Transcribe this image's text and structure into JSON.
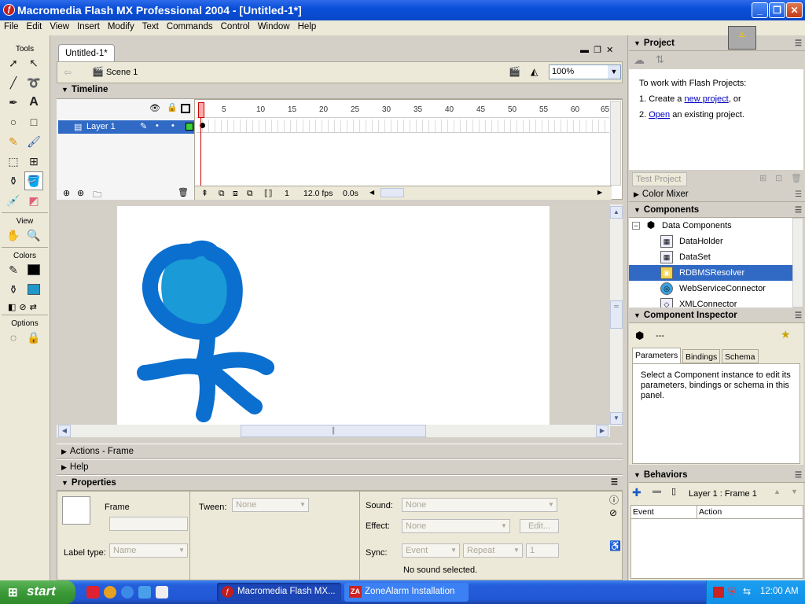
{
  "window": {
    "title": "Macromedia Flash MX Professional 2004 - [Untitled-1*]"
  },
  "menu": [
    "File",
    "Edit",
    "View",
    "Insert",
    "Modify",
    "Text",
    "Commands",
    "Control",
    "Window",
    "Help"
  ],
  "tools": {
    "section_tools": "Tools",
    "section_view": "View",
    "section_colors": "Colors",
    "section_options": "Options",
    "stroke_color": "#000000",
    "fill_color": "#2196c8"
  },
  "document": {
    "tab": "Untitled-1*",
    "scene": "Scene 1",
    "zoom": "100%"
  },
  "timeline": {
    "title": "Timeline",
    "layer_name": "Layer 1",
    "ruler": [
      "1",
      "5",
      "10",
      "15",
      "20",
      "25",
      "30",
      "35",
      "40",
      "45",
      "50",
      "55",
      "60",
      "65"
    ],
    "current_frame": "1",
    "fps": "12.0 fps",
    "time": "0.0s"
  },
  "panels": {
    "actions": "Actions - Frame",
    "help": "Help",
    "properties": "Properties"
  },
  "properties": {
    "frame_label": "Frame",
    "tween_label": "Tween:",
    "tween_value": "None",
    "sound_label": "Sound:",
    "sound_value": "None",
    "effect_label": "Effect:",
    "effect_value": "None",
    "edit_button": "Edit...",
    "label_type_label": "Label type:",
    "label_type_value": "Name",
    "sync_label": "Sync:",
    "sync_event": "Event",
    "sync_repeat": "Repeat",
    "sync_count": "1",
    "sound_status": "No sound selected."
  },
  "project": {
    "title": "Project",
    "intro": "To work with Flash Projects:",
    "step1_pre": "1. Create a ",
    "step1_link": "new project",
    "step1_post": ", or",
    "step2_pre": "2. ",
    "step2_link": "Open",
    "step2_post": " an existing project.",
    "test_button": "Test Project"
  },
  "color_mixer": {
    "title": "Color Mixer"
  },
  "components": {
    "title": "Components",
    "group": "Data Components",
    "items": [
      "DataHolder",
      "DataSet",
      "RDBMSResolver",
      "WebServiceConnector",
      "XMLConnector"
    ],
    "selected": "RDBMSResolver"
  },
  "inspector": {
    "title": "Component Inspector",
    "value": "---",
    "tabs": [
      "Parameters",
      "Bindings",
      "Schema"
    ],
    "message": "Select a Component instance to edit its parameters, bindings or schema in this panel."
  },
  "behaviors": {
    "title": "Behaviors",
    "context": "Layer 1 : Frame 1",
    "col_event": "Event",
    "col_action": "Action"
  },
  "taskbar": {
    "start": "start",
    "tasks": [
      "Macromedia Flash MX...",
      "ZoneAlarm Installation"
    ],
    "clock": "12:00 AM"
  },
  "drawing": {
    "stroke": "#0a6fcf",
    "fill": "#1a9ad6"
  }
}
